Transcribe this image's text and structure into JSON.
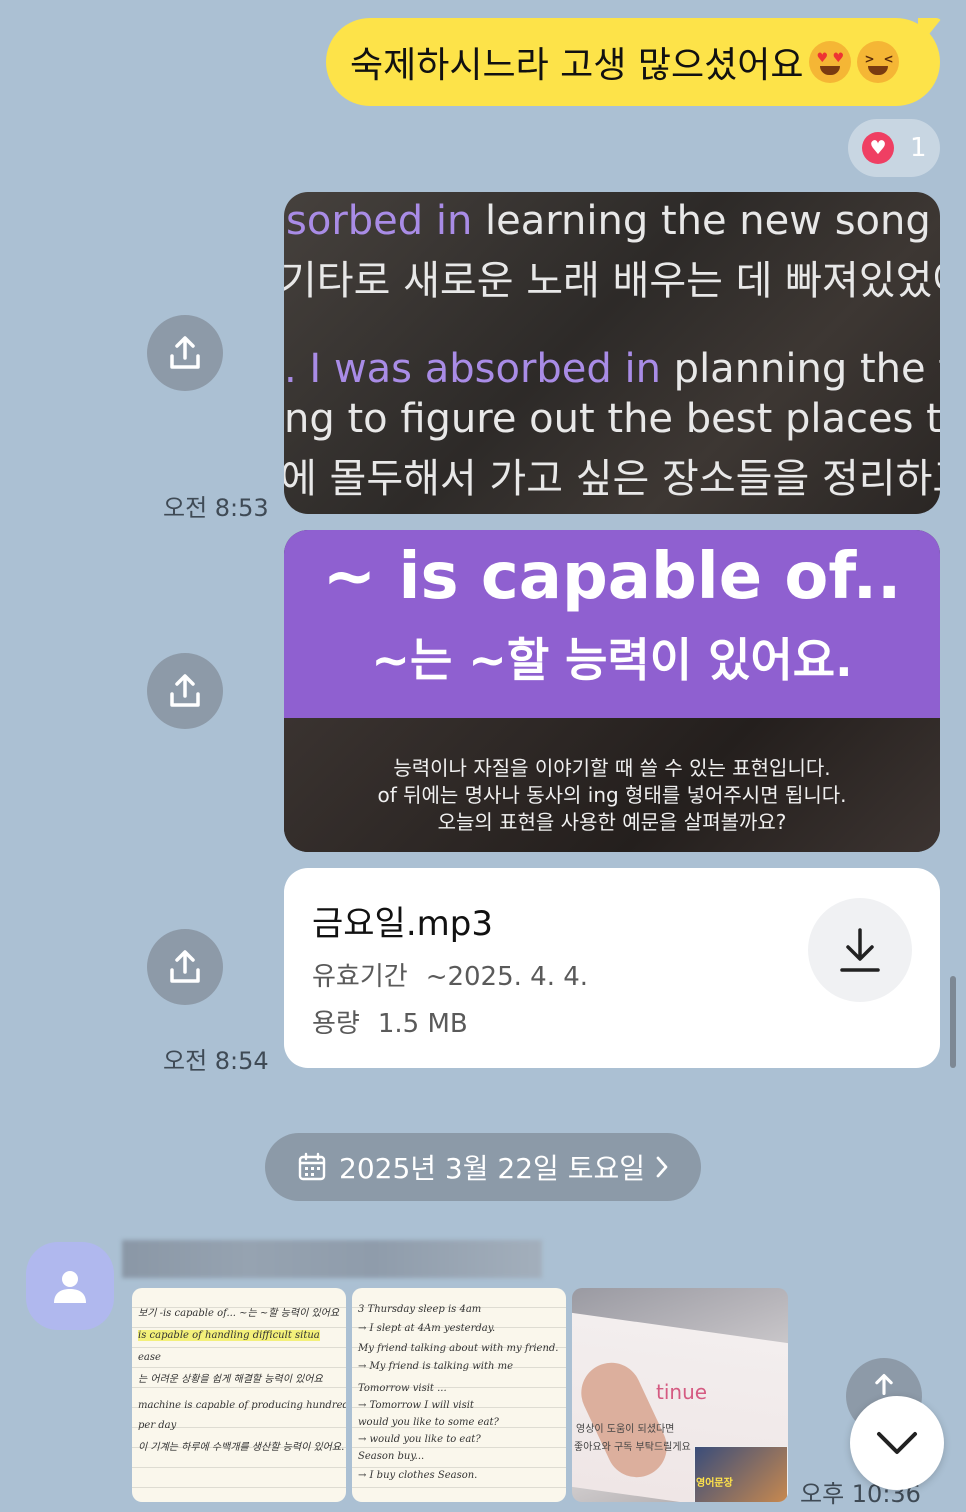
{
  "outgoing_message": {
    "text": "숙제하시느라 고생 많으셨어요"
  },
  "reaction": {
    "count": "1"
  },
  "image1": {
    "lines": [
      {
        "purple": "sorbed in ",
        "white": "learning the new song or"
      },
      {
        "purple": "",
        "white": "기타로 새로운 노래 배우는 데 빠져있었어"
      },
      {
        "purple": ". I was absorbed in ",
        "white": "planning the tri"
      },
      {
        "purple": "",
        "white": "ng to figure out the best places to v"
      },
      {
        "purple": "",
        "white": "에 몰두해서 가고 싶은 장소들을 정리하고"
      }
    ]
  },
  "time_1": "오전 8:53",
  "image2": {
    "title": "~ is capable of..",
    "subtitle": "~는 ~할 능력이 있어요.",
    "desc": [
      "능력이나 자질을 이야기할 때 쓸 수 있는 표현입니다.",
      "of 뒤에는 명사나 동사의 ing 형태를 넣어주시면 됩니다.",
      "오늘의 표현을 사용한 예문을 살펴볼까요?"
    ]
  },
  "file": {
    "name": "금요일.mp3",
    "expiry_label": "유효기간",
    "expiry_value": "~2025. 4. 4.",
    "size_label": "용량",
    "size_value": "1.5 MB"
  },
  "time_2": "오전 8:54",
  "date_separator": "2025년 3월 22일 토요일",
  "note1": {
    "lines": [
      "보기 -is capable of... ~는 ~할 능력이 있어요",
      "is capable of handling difficult situa",
      "ease",
      "는 어려운 상황을 쉽게 해결할 능력이 있어요",
      "",
      "machine is capable of producing hundreds",
      "per day",
      "이 기계는 하루에 수백개를 생산할 능력이 있어요."
    ]
  },
  "note2": {
    "lines": [
      "3 Thursday sleep is 4am",
      "→ I slept at 4Am yesterday.",
      "My friend talking about with my friend.",
      "→ My friend is talking with me",
      "Tomorrow visit ...",
      "→ Tomorrow I will visit",
      "would you like to some eat?",
      "→ would you like to eat?",
      "Season buy...",
      "→ I buy clothes Season."
    ]
  },
  "photo3": {
    "word": "tinue",
    "text1": "영상이 도움이 되셨다면",
    "text2": "좋아요와 구독 부탁드릴게요",
    "thumb_text": "영어문장"
  },
  "time_3": "오후 10:36"
}
